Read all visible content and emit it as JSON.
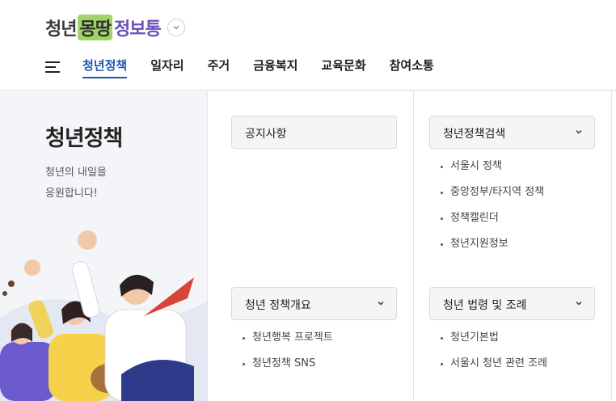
{
  "header": {
    "logo_part1": "청년",
    "logo_part2": "몽땅",
    "logo_part3": "정보통",
    "toggle_icon": "chevron-down-icon",
    "menu_icon": "hamburger-icon",
    "nav": [
      {
        "label": "청년정책",
        "active": true
      },
      {
        "label": "일자리",
        "active": false
      },
      {
        "label": "주거",
        "active": false
      },
      {
        "label": "금융복지",
        "active": false
      },
      {
        "label": "교육문화",
        "active": false
      },
      {
        "label": "참여소통",
        "active": false
      }
    ]
  },
  "side": {
    "title": "청년정책",
    "subtitle_line1": "청년의 내일을",
    "subtitle_line2": "응원합니다!"
  },
  "menus": {
    "notice": {
      "label": "공지사항"
    },
    "search": {
      "label": "청년정책검색",
      "items": [
        "서울시 정책",
        "중앙정부/타지역 정책",
        "정책캘린더",
        "청년지원정보"
      ]
    },
    "overview": {
      "label": "청년 정책개요",
      "items": [
        "청년행복 프로젝트",
        "청년정책 SNS"
      ]
    },
    "law": {
      "label": "청년 법령 및 조례",
      "items": [
        "청년기본법",
        "서울시 청년 관련 조례"
      ]
    }
  },
  "colors": {
    "accent": "#1a56b8",
    "logo_green": "#9fd468",
    "logo_purple": "#6a4fb5"
  }
}
